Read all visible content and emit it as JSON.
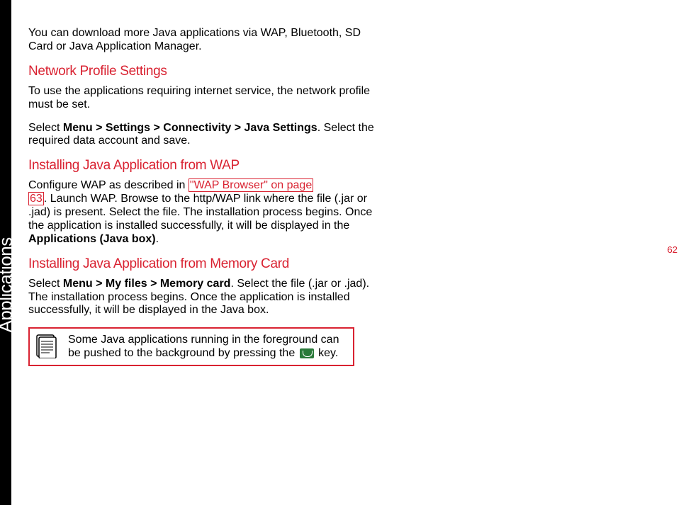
{
  "sidebar": {
    "label": "Applications"
  },
  "page_number": "62",
  "intro": "You can download more Java applications via WAP, Bluetooth, SD Card or Java Application Manager.",
  "section1": {
    "heading": "Network Profile Settings",
    "p1": "To use the applications requiring internet service, the network profile must be set.",
    "p2a": "Select ",
    "p2b": "Menu > Settings > Connectivity > Java Settings",
    "p2c": ". Select the required data account and save."
  },
  "section2": {
    "heading": "Installing Java Application from WAP",
    "p1a": "Configure WAP as described in ",
    "link1": "\"WAP Browser\" on page ",
    "link2": "63",
    "p1b": ". Launch WAP. Browse to the http/WAP link where the file (.jar or .jad) is present. Select the file. The installation process begins. Once the application is installed successfully, it will be displayed in the ",
    "p1c": "Applications (Java box)",
    "p1d": "."
  },
  "section3": {
    "heading": "Installing Java Application from Memory Card",
    "p1a": "Select ",
    "p1b": "Menu > My files > Memory card",
    "p1c": ". Select the file (.jar or .jad). The installation process begins. Once the application is installed successfully, it will be displayed in the Java box."
  },
  "note": {
    "t1": "Some Java applications running in the foreground can be pushed to the background by pressing the ",
    "t2": " key."
  }
}
